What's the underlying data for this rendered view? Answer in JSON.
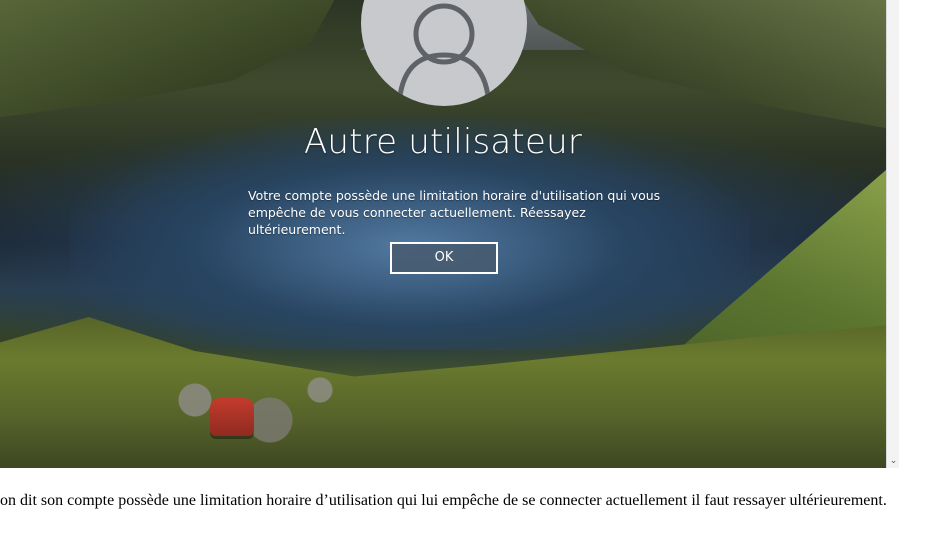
{
  "login_screen": {
    "user_name": "Autre utilisateur",
    "message": "Votre compte possède une limitation horaire d'utilisation qui vous empêche de vous connecter actuellement. Réessayez ultérieurement.",
    "ok_label": "OK",
    "avatar_icon": "user-silhouette-icon"
  },
  "scrollbar": {
    "down_arrow_icon": "chevron-down-icon",
    "down_arrow_glyph": "⌄"
  },
  "caption": {
    "text": "on dit son compte possède une limitation horaire d’utilisation qui lui empêche de se connecter actuellement il faut ressayer ultérieurement."
  },
  "colors": {
    "button_border": "#ffffff",
    "text": "#ffffff",
    "caption_text": "#000000"
  }
}
